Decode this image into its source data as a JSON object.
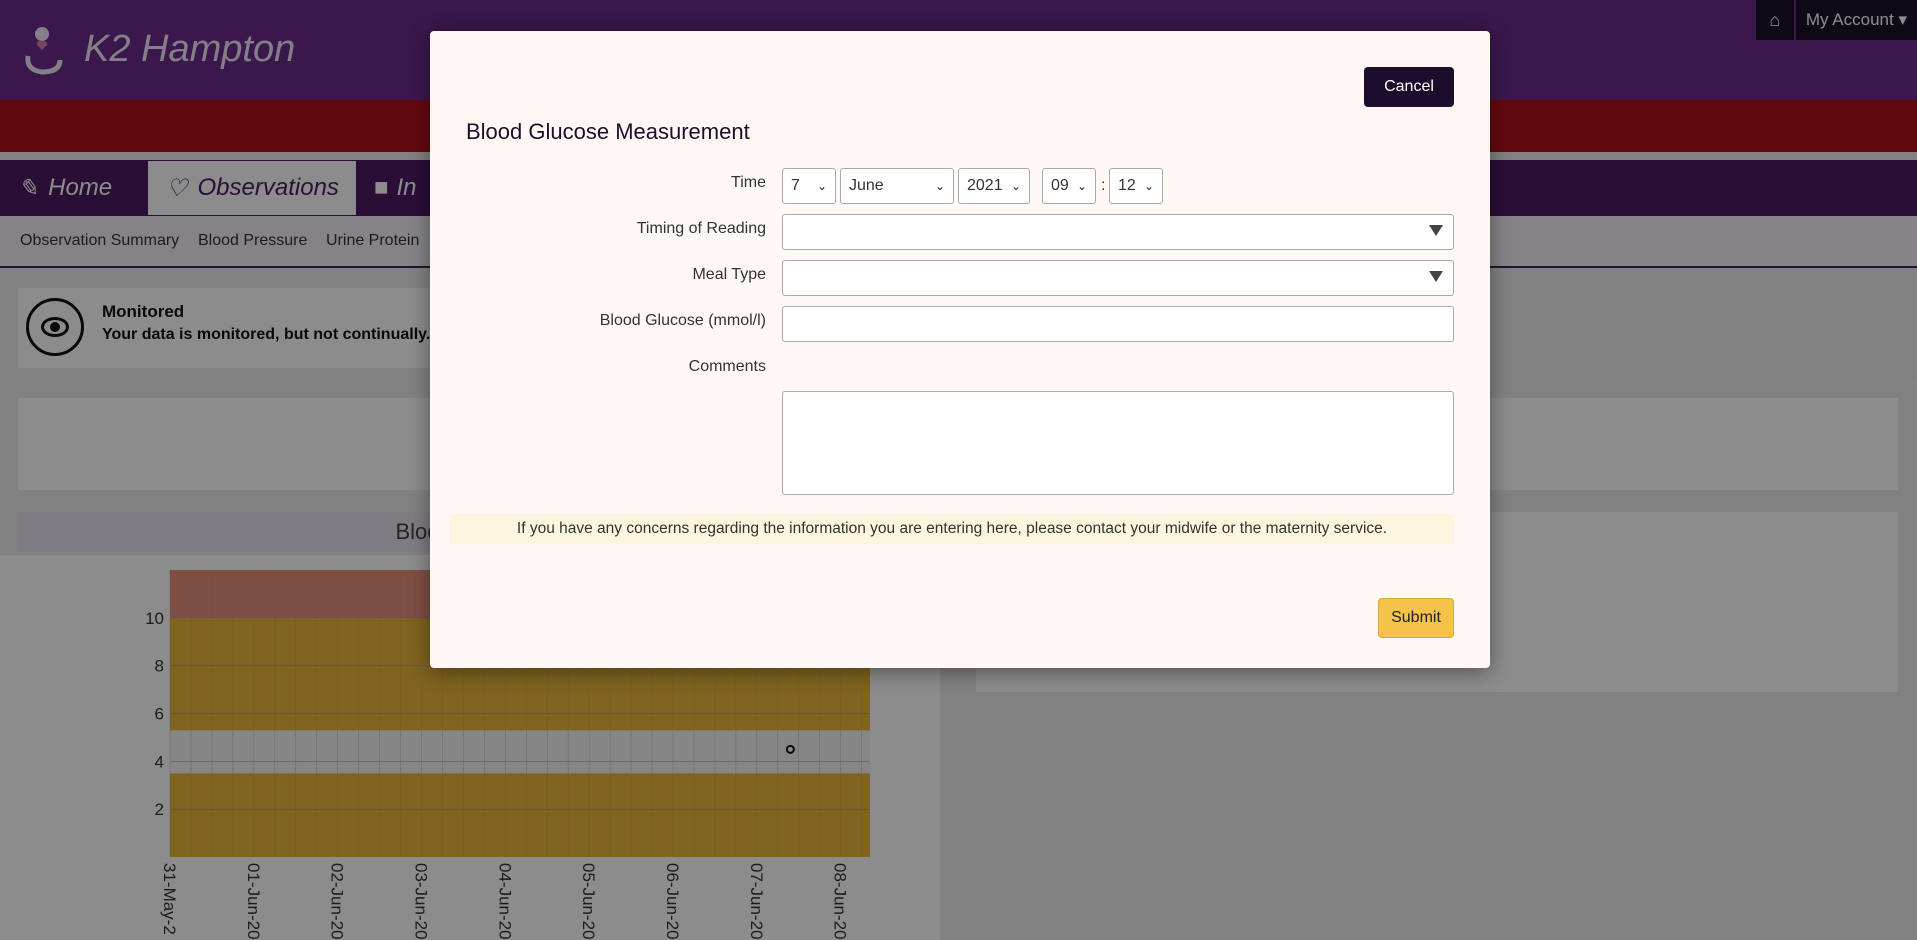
{
  "app": {
    "title": "K2 Hampton"
  },
  "topbar": {
    "home_icon": "home-icon",
    "account_label": "My Account ▾"
  },
  "nav": {
    "tabs": [
      {
        "label": "Home",
        "icon": "edit-icon"
      },
      {
        "label": "Observations",
        "icon": "heart-icon"
      },
      {
        "label": "In",
        "icon": "book-icon"
      }
    ]
  },
  "subnav": {
    "items": [
      "Observation Summary",
      "Blood Pressure",
      "Urine Protein"
    ]
  },
  "monitor": {
    "title": "Monitored",
    "subtitle": "Your data is monitored, but not continually."
  },
  "chart_panel": {
    "title": "Blood Glucose C"
  },
  "chart_data": {
    "type": "scatter",
    "title": "Blood Glucose C",
    "xlabel": "",
    "ylabel": "",
    "ylim": [
      0,
      12
    ],
    "yticks": [
      2,
      4,
      6,
      8,
      10
    ],
    "xticks": [
      "31-May-2",
      "01-Jun-20",
      "02-Jun-20",
      "03-Jun-20",
      "04-Jun-20",
      "05-Jun-20",
      "06-Jun-20",
      "07-Jun-20",
      "08-Jun-20"
    ],
    "x": [
      7.4
    ],
    "y": [
      4.5
    ],
    "bands": [
      {
        "from": 0,
        "to": 3.5,
        "color": "#e8b43a"
      },
      {
        "from": 3.5,
        "to": 5.3,
        "color": "#f5f5f5"
      },
      {
        "from": 5.3,
        "to": 10,
        "color": "#e8b43a"
      },
      {
        "from": 10,
        "to": 12,
        "color": "#e88e7c"
      }
    ]
  },
  "modal": {
    "title": "Blood Glucose Measurement",
    "cancel_label": "Cancel",
    "submit_label": "Submit",
    "time": {
      "label": "Time",
      "day": "7",
      "month": "June",
      "year": "2021",
      "hour": "09",
      "minute": "12",
      "separator": ":"
    },
    "timing_label": "Timing of Reading",
    "meal_label": "Meal Type",
    "glucose_label": "Blood Glucose (mmol/l)",
    "comments_label": "Comments",
    "notice": "If you have any concerns regarding the information you are entering here, please contact your midwife or the maternity service."
  }
}
